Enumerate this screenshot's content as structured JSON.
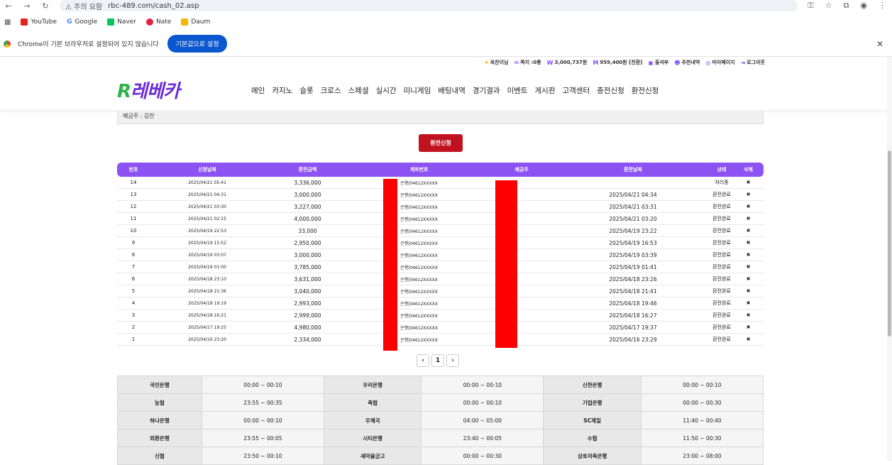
{
  "browser": {
    "warning": "주의 요함",
    "url": "rbc-489.com/cash_02.asp",
    "bookmarks": [
      "YouTube",
      "Google",
      "Naver",
      "Nate",
      "Daum"
    ],
    "infobar_text": "Chrome이 기본 브라우저로 설정되어 있지 않습니다",
    "infobar_button": "기본값으로 설정"
  },
  "user_bar": {
    "name": "욱찬이님",
    "messages": "쪽지 :0통",
    "money": "3,000,737원",
    "points": "959,400원 [전환]",
    "attendance": "출석부",
    "recommend": "추천내역",
    "mypage": "마이페이지",
    "logout": "로그아웃"
  },
  "logo": {
    "r": "R",
    "text": "레베카"
  },
  "menu": [
    "메인",
    "카지노",
    "슬롯",
    "크로스",
    "스페셜",
    "실시간",
    "미니게임",
    "배팅내역",
    "경기결과",
    "이벤트",
    "게시판",
    "고객센터",
    "충전신청",
    "환전신청"
  ],
  "depositor": "예금주 : 김찬",
  "exchange_button": "환전신청",
  "table": {
    "headers": [
      "번호",
      "신청날짜",
      "환전금액",
      "계좌번호",
      "예금주",
      "환전날짜",
      "상태",
      "삭제"
    ],
    "rows": [
      {
        "no": "14",
        "date": "2025/04/21 05:41",
        "amount": "3,336,000",
        "acct": "은행|04612XXXXX",
        "exdate": "",
        "status": "처리중"
      },
      {
        "no": "13",
        "date": "2025/04/21 04:31",
        "amount": "3,000,000",
        "acct": "은행|04612XXXXX",
        "exdate": "2025/04/21 04:34",
        "status": "환전완료"
      },
      {
        "no": "12",
        "date": "2025/04/21 03:30",
        "amount": "3,227,000",
        "acct": "은행|04612XXXXX",
        "exdate": "2025/04/21 03:31",
        "status": "환전완료"
      },
      {
        "no": "11",
        "date": "2025/04/21 02:15",
        "amount": "4,000,000",
        "acct": "은행|04612XXXXX",
        "exdate": "2025/04/21 03:20",
        "status": "환전완료"
      },
      {
        "no": "10",
        "date": "2025/04/19 22:53",
        "amount": "33,000",
        "acct": "은행|04612XXXXX",
        "exdate": "2025/04/19 23:22",
        "status": "환전완료"
      },
      {
        "no": "9",
        "date": "2025/04/19 15:52",
        "amount": "2,950,000",
        "acct": "은행|04612XXXXX",
        "exdate": "2025/04/19 16:53",
        "status": "환전완료"
      },
      {
        "no": "8",
        "date": "2025/04/19 03:07",
        "amount": "3,000,000",
        "acct": "은행|04612XXXXX",
        "exdate": "2025/04/19 03:39",
        "status": "환전완료"
      },
      {
        "no": "7",
        "date": "2025/04/19 01:00",
        "amount": "3,785,000",
        "acct": "은행|04612XXXXX",
        "exdate": "2025/04/19 01:41",
        "status": "환전완료"
      },
      {
        "no": "6",
        "date": "2025/04/18 23:10",
        "amount": "3,631,000",
        "acct": "은행|04612XXXXX",
        "exdate": "2025/04/18 23:26",
        "status": "환전완료"
      },
      {
        "no": "5",
        "date": "2025/04/18 21:36",
        "amount": "3,040,000",
        "acct": "은행|04612XXXXX",
        "exdate": "2025/04/18 21:41",
        "status": "환전완료"
      },
      {
        "no": "4",
        "date": "2025/04/18 19:19",
        "amount": "2,993,000",
        "acct": "은행|04612XXXXX",
        "exdate": "2025/04/18 19:46",
        "status": "환전완료"
      },
      {
        "no": "3",
        "date": "2025/04/18 16:21",
        "amount": "2,999,000",
        "acct": "은행|04612XXXXX",
        "exdate": "2025/04/18 16:27",
        "status": "환전완료"
      },
      {
        "no": "2",
        "date": "2025/04/17 19:25",
        "amount": "4,980,000",
        "acct": "은행|04612XXXXX",
        "exdate": "2025/04/17 19:37",
        "status": "환전완료"
      },
      {
        "no": "1",
        "date": "2025/04/16 23:20",
        "amount": "2,334,000",
        "acct": "은행|04612XXXXX",
        "exdate": "2025/04/16 23:29",
        "status": "환전완료"
      }
    ],
    "delete_glyph": "✖"
  },
  "pager": {
    "prev": "‹",
    "page": "1",
    "next": "›"
  },
  "banks": [
    [
      [
        "국민은행",
        "00:00 ~ 00:10"
      ],
      [
        "우리은행",
        "00:00 ~ 00:10"
      ],
      [
        "신한은행",
        "00:00 ~ 00:10"
      ]
    ],
    [
      [
        "농협",
        "23:55 ~ 00:35"
      ],
      [
        "축협",
        "00:00 ~ 00:10"
      ],
      [
        "기업은행",
        "00:00 ~ 00:30"
      ]
    ],
    [
      [
        "하나은행",
        "00:00 ~ 00:10"
      ],
      [
        "우체국",
        "04:00 ~ 05:00"
      ],
      [
        "SC제일",
        "11:40 ~ 00:40"
      ]
    ],
    [
      [
        "외환은행",
        "23:55 ~ 00:05"
      ],
      [
        "시티은행",
        "23:40 ~ 00:05"
      ],
      [
        "수협",
        "11:50 ~ 00:30"
      ]
    ],
    [
      [
        "신협",
        "23:50 ~ 00:10"
      ],
      [
        "새마을금고",
        "00:00 ~ 00:30"
      ],
      [
        "상호저축은행",
        "23:00 ~ 08:00"
      ]
    ]
  ]
}
